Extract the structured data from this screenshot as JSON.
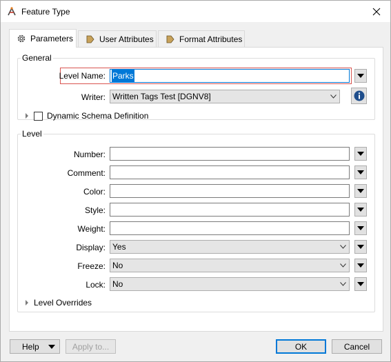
{
  "window": {
    "title": "Feature Type"
  },
  "tabs": [
    {
      "label": "Parameters",
      "icon": "gear-icon",
      "active": true
    },
    {
      "label": "User Attributes",
      "icon": "arrow-right-icon",
      "active": false
    },
    {
      "label": "Format Attributes",
      "icon": "arrow-right-icon",
      "active": false
    }
  ],
  "general": {
    "legend": "General",
    "level_name": {
      "label": "Level Name:",
      "value": "Parks"
    },
    "writer": {
      "label": "Writer:",
      "value": "Written Tags Test [DGNV8]"
    },
    "dynamic_schema": {
      "label": "Dynamic Schema Definition",
      "checked": false
    }
  },
  "level": {
    "legend": "Level",
    "number": {
      "label": "Number:",
      "value": ""
    },
    "comment": {
      "label": "Comment:",
      "value": ""
    },
    "color": {
      "label": "Color:",
      "value": ""
    },
    "style": {
      "label": "Style:",
      "value": ""
    },
    "weight": {
      "label": "Weight:",
      "value": ""
    },
    "display": {
      "label": "Display:",
      "value": "Yes"
    },
    "freeze": {
      "label": "Freeze:",
      "value": "No"
    },
    "lock": {
      "label": "Lock:",
      "value": "No"
    },
    "overrides": {
      "label": "Level Overrides"
    }
  },
  "footer": {
    "help": "Help",
    "apply": "Apply to...",
    "ok": "OK",
    "cancel": "Cancel"
  },
  "colors": {
    "accent": "#0078d7",
    "highlight_border": "#d9534f",
    "selection": "#0078d7"
  }
}
